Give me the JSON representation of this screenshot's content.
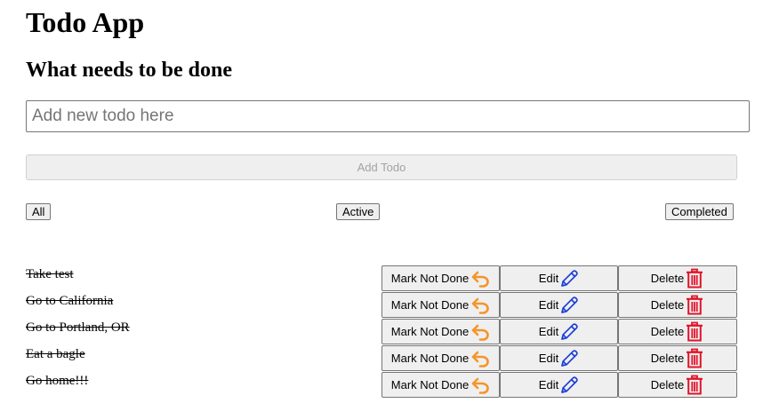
{
  "header": {
    "title": "Todo App",
    "subtitle": "What needs to be done"
  },
  "new_todo": {
    "value": "",
    "placeholder": "Add new todo here",
    "add_label": "Add Todo"
  },
  "filters": {
    "all": "All",
    "active": "Active",
    "completed": "Completed"
  },
  "todos": [
    {
      "text": "Take test",
      "done": true
    },
    {
      "text": "Go to California",
      "done": true
    },
    {
      "text": "Go to Portland, OR",
      "done": true
    },
    {
      "text": "Eat a bagle",
      "done": true
    },
    {
      "text": "Go home!!!",
      "done": true
    }
  ],
  "actions": {
    "toggle_label": "Mark Not Done",
    "edit_label": "Edit",
    "delete_label": "Delete"
  },
  "icons": {
    "toggle": "undo-icon",
    "edit": "pencil-icon",
    "delete": "trash-icon"
  },
  "colors": {
    "undo_icon": "#f5952a",
    "edit_icon": "#1d3fd6",
    "delete_icon": "#e0142a"
  }
}
